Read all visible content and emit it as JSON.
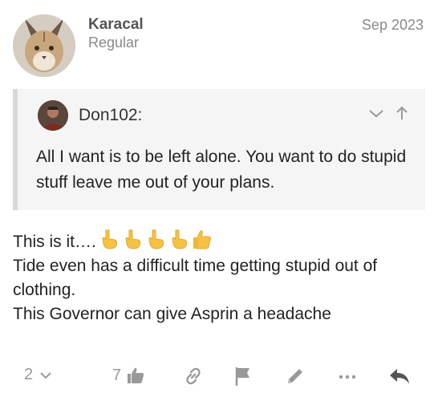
{
  "post": {
    "author": {
      "name": "Karacal",
      "title": "Regular",
      "avatar_icon": "caracal-avatar"
    },
    "date": "Sep 2023",
    "quote": {
      "user": "Don102:",
      "text": "All I want is to be left alone. You want to do stupid stuff leave me out of your plans.",
      "avatar_icon": "user-avatar"
    },
    "body": {
      "line1": "This is it….",
      "line2": "Tide even has a difficult time getting stupid out of clothing.",
      "line3": "This Governor can give Asprin a headache"
    },
    "actions": {
      "replies_count": "2",
      "likes_count": "7"
    },
    "colors": {
      "quote_bg": "#f5f5f5",
      "quote_border": "#d8d8d8",
      "muted": "#999999",
      "reply_icon": "#555555",
      "emoji_yellow": "#f7c243"
    }
  }
}
